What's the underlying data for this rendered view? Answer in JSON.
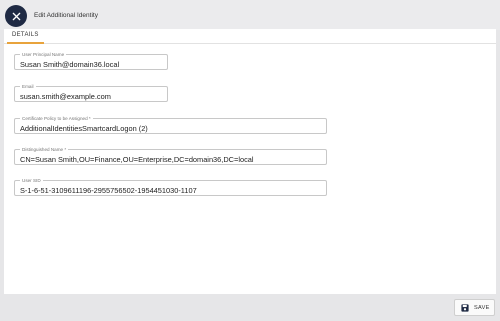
{
  "header": {
    "title": "Edit Additional Identity",
    "close_icon": "close-icon"
  },
  "tabs": [
    {
      "label": "DETAILS",
      "active": true
    }
  ],
  "fields": {
    "upn": {
      "label": "User Principal Name",
      "value": "Susan Smith@domain36.local"
    },
    "email": {
      "label": "Email",
      "value": "susan.smith@example.com"
    },
    "policy": {
      "label": "Certificate Policy to be Assigned *",
      "value": "AdditionalIdentitiesSmartcardLogon (2)"
    },
    "dn": {
      "label": "Distinguished Name *",
      "value": "CN=Susan Smith,OU=Finance,OU=Enterprise,DC=domain36,DC=local"
    },
    "sid": {
      "label": "User SID",
      "value": "S-1-6-51-3109611196-2955756502-1954451030-1107"
    }
  },
  "footer": {
    "save_label": "SAVE",
    "save_icon": "save-icon"
  },
  "colors": {
    "accent_tab": "#e8a33c",
    "close_button": "#1f2a44"
  }
}
